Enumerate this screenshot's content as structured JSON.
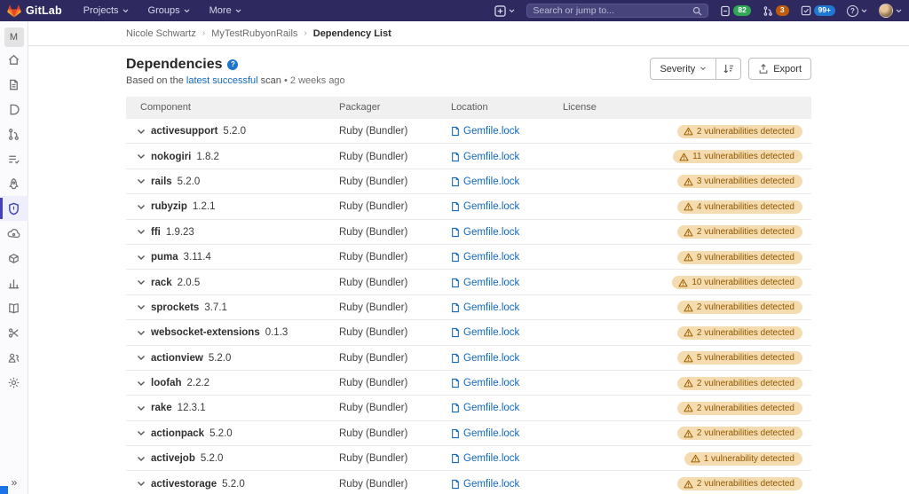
{
  "navbar": {
    "brand": "GitLab",
    "menus": [
      "Projects",
      "Groups",
      "More"
    ],
    "search": {
      "placeholder": "Search or jump to..."
    },
    "counters": {
      "issues": "82",
      "merge_requests": "3",
      "todos": "99+"
    }
  },
  "sidebar": {
    "project_initial": "M",
    "collapse_glyph": "»"
  },
  "breadcrumb": {
    "group": "Nicole Schwartz",
    "project": "MyTestRubyonRails",
    "current": "Dependency List"
  },
  "page": {
    "title": "Dependencies",
    "help_glyph": "?",
    "subtitle_prefix": "Based on the",
    "subtitle_link": "latest successful",
    "subtitle_mid": "scan",
    "subtitle_sep": "•",
    "subtitle_time": "2 weeks ago",
    "actions": {
      "severity": "Severity",
      "export": "Export"
    }
  },
  "table": {
    "columns": [
      "Component",
      "Packager",
      "Location",
      "License"
    ],
    "rows": [
      {
        "name": "activesupport",
        "version": "5.2.0",
        "packager": "Ruby (Bundler)",
        "location": "Gemfile.lock",
        "vulnerabilities": "2 vulnerabilities detected"
      },
      {
        "name": "nokogiri",
        "version": "1.8.2",
        "packager": "Ruby (Bundler)",
        "location": "Gemfile.lock",
        "vulnerabilities": "11 vulnerabilities detected"
      },
      {
        "name": "rails",
        "version": "5.2.0",
        "packager": "Ruby (Bundler)",
        "location": "Gemfile.lock",
        "vulnerabilities": "3 vulnerabilities detected"
      },
      {
        "name": "rubyzip",
        "version": "1.2.1",
        "packager": "Ruby (Bundler)",
        "location": "Gemfile.lock",
        "vulnerabilities": "4 vulnerabilities detected"
      },
      {
        "name": "ffi",
        "version": "1.9.23",
        "packager": "Ruby (Bundler)",
        "location": "Gemfile.lock",
        "vulnerabilities": "2 vulnerabilities detected"
      },
      {
        "name": "puma",
        "version": "3.11.4",
        "packager": "Ruby (Bundler)",
        "location": "Gemfile.lock",
        "vulnerabilities": "9 vulnerabilities detected"
      },
      {
        "name": "rack",
        "version": "2.0.5",
        "packager": "Ruby (Bundler)",
        "location": "Gemfile.lock",
        "vulnerabilities": "10 vulnerabilities detected"
      },
      {
        "name": "sprockets",
        "version": "3.7.1",
        "packager": "Ruby (Bundler)",
        "location": "Gemfile.lock",
        "vulnerabilities": "2 vulnerabilities detected"
      },
      {
        "name": "websocket-extensions",
        "version": "0.1.3",
        "packager": "Ruby (Bundler)",
        "location": "Gemfile.lock",
        "vulnerabilities": "2 vulnerabilities detected"
      },
      {
        "name": "actionview",
        "version": "5.2.0",
        "packager": "Ruby (Bundler)",
        "location": "Gemfile.lock",
        "vulnerabilities": "5 vulnerabilities detected"
      },
      {
        "name": "loofah",
        "version": "2.2.2",
        "packager": "Ruby (Bundler)",
        "location": "Gemfile.lock",
        "vulnerabilities": "2 vulnerabilities detected"
      },
      {
        "name": "rake",
        "version": "12.3.1",
        "packager": "Ruby (Bundler)",
        "location": "Gemfile.lock",
        "vulnerabilities": "2 vulnerabilities detected"
      },
      {
        "name": "actionpack",
        "version": "5.2.0",
        "packager": "Ruby (Bundler)",
        "location": "Gemfile.lock",
        "vulnerabilities": "2 vulnerabilities detected"
      },
      {
        "name": "activejob",
        "version": "5.2.0",
        "packager": "Ruby (Bundler)",
        "location": "Gemfile.lock",
        "vulnerabilities": "1 vulnerability detected"
      },
      {
        "name": "activestorage",
        "version": "5.2.0",
        "packager": "Ruby (Bundler)",
        "location": "Gemfile.lock",
        "vulnerabilities": "2 vulnerabilities detected"
      }
    ]
  },
  "colors": {
    "navbar_bg": "#2e2a60",
    "link": "#1068bf",
    "warning_badge_bg": "#f5dcb0",
    "warning_badge_text": "#8f5700",
    "issues_badge": "#31a656",
    "mr_badge": "#c05b0a",
    "todo_badge": "#1f78d1",
    "sidebar_active": "#4242b8"
  }
}
